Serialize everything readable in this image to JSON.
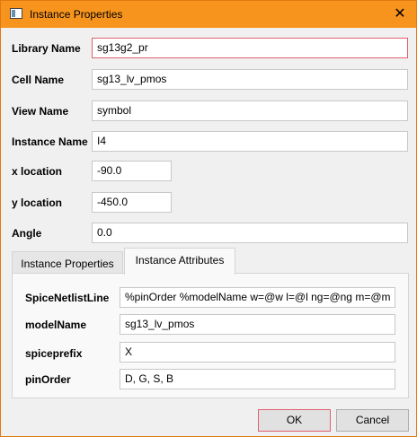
{
  "window": {
    "title": "Instance Properties",
    "close_glyph": "✕"
  },
  "form": {
    "library_name": {
      "label": "Library Name",
      "value": "sg13g2_pr"
    },
    "cell_name": {
      "label": "Cell Name",
      "value": "sg13_lv_pmos"
    },
    "view_name": {
      "label": "View Name",
      "value": "symbol"
    },
    "instance_name": {
      "label": "Instance Name",
      "value": "I4"
    },
    "x_location": {
      "label": "x location",
      "value": "-90.0"
    },
    "y_location": {
      "label": "y location",
      "value": "-450.0"
    },
    "angle": {
      "label": "Angle",
      "value": "0.0"
    }
  },
  "tabs": [
    {
      "label": "Instance Properties",
      "active": false
    },
    {
      "label": "Instance Attributes",
      "active": true
    }
  ],
  "attributes": {
    "spice_netlist_line": {
      "label": "SpiceNetlistLine",
      "value": "%pinOrder %modelName w=@w l=@l ng=@ng m=@m"
    },
    "model_name": {
      "label": "modelName",
      "value": "sg13_lv_pmos"
    },
    "spice_prefix": {
      "label": "spiceprefix",
      "value": "X"
    },
    "pin_order": {
      "label": "pinOrder",
      "value": "D, G, S, B"
    }
  },
  "buttons": {
    "ok": "OK",
    "cancel": "Cancel"
  }
}
